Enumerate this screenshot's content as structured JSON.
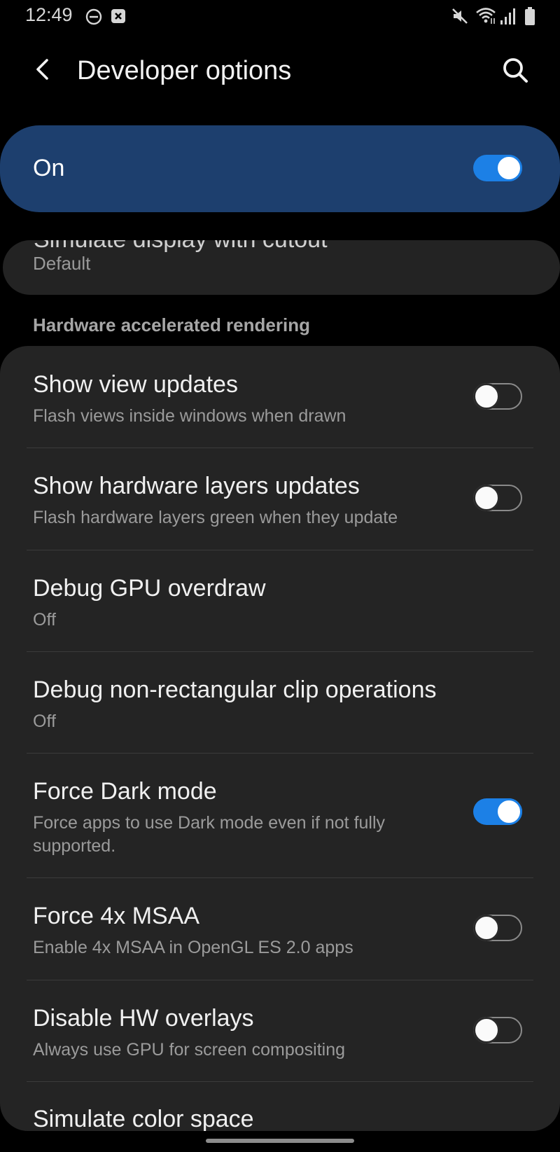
{
  "status_bar": {
    "time": "12:49",
    "icons": [
      "dnd-icon",
      "notification-icon",
      "mute-icon",
      "wifi-icon",
      "signal-icon",
      "battery-icon"
    ]
  },
  "header": {
    "title": "Developer options",
    "back_icon": "chevron-left-icon",
    "search_icon": "search-icon"
  },
  "master_switch": {
    "label": "On",
    "state": true,
    "accent_color": "#1c80e6",
    "card_color": "#1d3f6e"
  },
  "clipped_item": {
    "title": "Simulate display with cutout",
    "summary": "Default"
  },
  "section": {
    "header": "Hardware accelerated rendering"
  },
  "settings": [
    {
      "title": "Show view updates",
      "summary": "Flash views inside windows when drawn",
      "toggle": false
    },
    {
      "title": "Show hardware layers updates",
      "summary": "Flash hardware layers green when they update",
      "toggle": false
    },
    {
      "title": "Debug GPU overdraw",
      "summary": "Off"
    },
    {
      "title": "Debug non-rectangular clip operations",
      "summary": "Off"
    },
    {
      "title": "Force Dark mode",
      "summary": "Force apps to use Dark mode even if not fully supported.",
      "toggle": true
    },
    {
      "title": "Force 4x MSAA",
      "summary": "Enable 4x MSAA in OpenGL ES 2.0 apps",
      "toggle": false
    },
    {
      "title": "Disable HW overlays",
      "summary": "Always use GPU for screen compositing",
      "toggle": false
    },
    {
      "title": "Simulate color space"
    }
  ]
}
